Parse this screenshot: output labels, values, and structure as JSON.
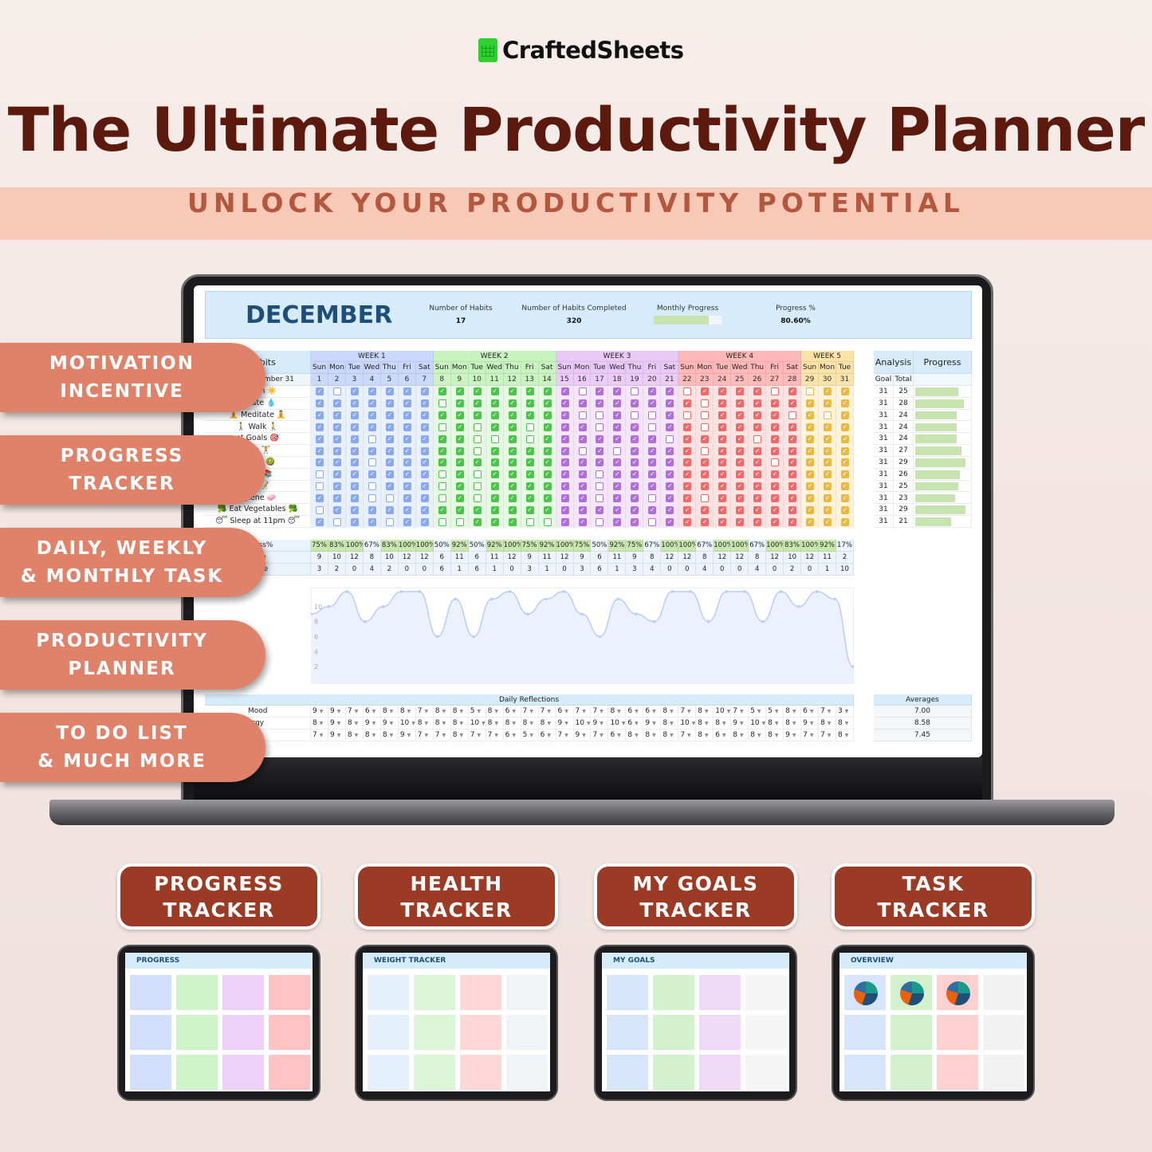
{
  "brand": {
    "name": "CraftedSheets"
  },
  "hero": {
    "title": "The Ultimate Productivity Planner",
    "subtitle": "UNLOCK YOUR PRODUCTIVITY POTENTIAL"
  },
  "features": [
    [
      "MOTIVATION",
      "INCENTIVE"
    ],
    [
      "PROGRESS",
      "TRACKER"
    ],
    [
      "DAILY, WEEKLY",
      "& MONTHLY TASK"
    ],
    [
      "PRODUCTIVITY",
      "PLANNER"
    ],
    [
      "TO DO LIST",
      "& MUCH MORE"
    ]
  ],
  "sheet": {
    "month": "DECEMBER",
    "kpis": [
      {
        "label": "Number of Habits",
        "value": "17"
      },
      {
        "label": "Number of Habits Completed",
        "value": "320"
      },
      {
        "label": "Monthly Progress",
        "value": ""
      },
      {
        "label": "Progress %",
        "value": "80.60%"
      }
    ],
    "monthly_progress": 0.806,
    "habits_header": "abits",
    "date_header": "ember 31",
    "weeks": [
      {
        "label": "WEEK 1",
        "head": "#c9d8fb",
        "bg": "#e8effd",
        "check": "#8aa8ee"
      },
      {
        "label": "WEEK 2",
        "head": "#c8f2c0",
        "bg": "#e6f9e2",
        "check": "#4cc44c"
      },
      {
        "label": "WEEK 3",
        "head": "#ebc9f7",
        "bg": "#f5e6fb",
        "check": "#b06fd8"
      },
      {
        "label": "WEEK 4",
        "head": "#ffb8b8",
        "bg": "#ffe3e3",
        "check": "#ee6a6a"
      },
      {
        "label": "WEEK 5",
        "head": "#fbe3a8",
        "bg": "#fff4d9",
        "check": "#e9b944"
      }
    ],
    "day_names": [
      "Sun",
      "Mon",
      "Tue",
      "Wed",
      "Thu",
      "Fri",
      "Sat"
    ],
    "habits": [
      {
        "name": "at 7am ☀️",
        "checks": "1011111111111110110110111101011110"
      },
      {
        "name": "ydrate 💧",
        "checks": "1111111011111111111111011111111110"
      },
      {
        "name": "🧘 Meditate 🧘",
        "checks": "1111111111111110010010011110101110"
      },
      {
        "name": "🚶 Walk 🚶",
        "checks": "1111111010110111011011011111111110"
      },
      {
        "name": "et Goals 🎯",
        "checks": "1110111110010111111101111011111110"
      },
      {
        "name": "cise 🏋️",
        "checks": "1111111110111110101111011111111111"
      },
      {
        "name": "akfast 🥝",
        "checks": "1110111111111111111111111101111111"
      },
      {
        "name": "ages 📚",
        "checks": "0111111010111111011111111111111110"
      },
      {
        "name": "nal 📝",
        "checks": "0110111010111111011111111111111110"
      },
      {
        "name": "ygiene 🧼",
        "checks": "1110011010111111011011011111111110"
      },
      {
        "name": "🥦 Eat Vegetables 🥦",
        "checks": "0111111111111111111111111111111110"
      },
      {
        "name": "😴 Sleep at 11pm 😴",
        "checks": "1011011001110011011011111111111100"
      }
    ],
    "analysis": {
      "title": "Analysis",
      "progress_title": "Progress",
      "goal_label": "Goal",
      "total_label": "Total",
      "goal": 31,
      "totals": [
        25,
        28,
        24,
        24,
        24,
        27,
        29,
        26,
        25,
        23,
        29,
        21
      ]
    },
    "stats": {
      "labels": [
        "ess%",
        "ete",
        "lete"
      ],
      "progress": [
        "75%",
        "83%",
        "100%",
        "67%",
        "83%",
        "100%",
        "100%",
        "50%",
        "92%",
        "50%",
        "92%",
        "100%",
        "75%",
        "92%",
        "100%",
        "75%",
        "50%",
        "92%",
        "75%",
        "67%",
        "100%",
        "100%",
        "67%",
        "100%",
        "100%",
        "67%",
        "100%",
        "83%",
        "100%",
        "92%",
        "17%"
      ],
      "complete": [
        9,
        10,
        12,
        8,
        10,
        12,
        12,
        6,
        11,
        6,
        11,
        12,
        9,
        11,
        12,
        9,
        6,
        11,
        9,
        8,
        12,
        12,
        8,
        12,
        12,
        8,
        12,
        10,
        12,
        11,
        2
      ],
      "incomplete": [
        3,
        2,
        0,
        4,
        2,
        0,
        0,
        6,
        1,
        6,
        1,
        0,
        3,
        1,
        0,
        3,
        6,
        1,
        3,
        4,
        0,
        0,
        4,
        0,
        0,
        4,
        0,
        2,
        0,
        1,
        10
      ]
    },
    "chart_data": {
      "type": "area",
      "yticks": [
        "2",
        "4",
        "6",
        "8",
        "10"
      ],
      "ylim": [
        0,
        12
      ],
      "x": "days 1-31",
      "values": [
        9,
        10,
        12,
        8,
        10,
        12,
        12,
        6,
        11,
        6,
        11,
        12,
        9,
        11,
        12,
        9,
        6,
        11,
        9,
        8,
        12,
        12,
        8,
        12,
        12,
        8,
        12,
        10,
        12,
        11,
        2
      ],
      "color": "#b8cdf8"
    },
    "reflections": {
      "title": "Daily Reflections",
      "averages_title": "Averages",
      "rows": [
        {
          "label": "Mood",
          "values": [
            9,
            9,
            7,
            6,
            8,
            8,
            7,
            8,
            8,
            5,
            8,
            6,
            7,
            7,
            6,
            7,
            7,
            8,
            6,
            6,
            8,
            7,
            8,
            10,
            7,
            5,
            5,
            8,
            6,
            7,
            3
          ],
          "average": "7.00"
        },
        {
          "label": "ergy",
          "values": [
            8,
            9,
            8,
            9,
            9,
            10,
            8,
            8,
            8,
            10,
            8,
            8,
            8,
            8,
            9,
            10,
            9,
            10,
            6,
            9,
            8,
            10,
            8,
            8,
            9,
            10,
            8,
            8,
            9,
            8,
            8
          ],
          "average": "8.58"
        },
        {
          "label": "tion",
          "values": [
            7,
            9,
            8,
            8,
            8,
            9,
            7,
            7,
            8,
            7,
            7,
            6,
            5,
            6,
            7,
            9,
            7,
            6,
            8,
            8,
            8,
            7,
            8,
            6,
            8,
            8,
            8,
            9,
            7,
            7,
            8
          ],
          "average": "7.45"
        }
      ]
    }
  },
  "products": [
    {
      "title": [
        "PROGRESS",
        "TRACKER"
      ],
      "screen_title": "PROGRESS"
    },
    {
      "title": [
        "HEALTH",
        "TRACKER"
      ],
      "screen_title": "WEIGHT TRACKER"
    },
    {
      "title": [
        "MY GOALS",
        "TRACKER"
      ],
      "screen_title": "MY GOALS"
    },
    {
      "title": [
        "TASK",
        "TRACKER"
      ],
      "screen_title": "OVERVIEW"
    }
  ]
}
